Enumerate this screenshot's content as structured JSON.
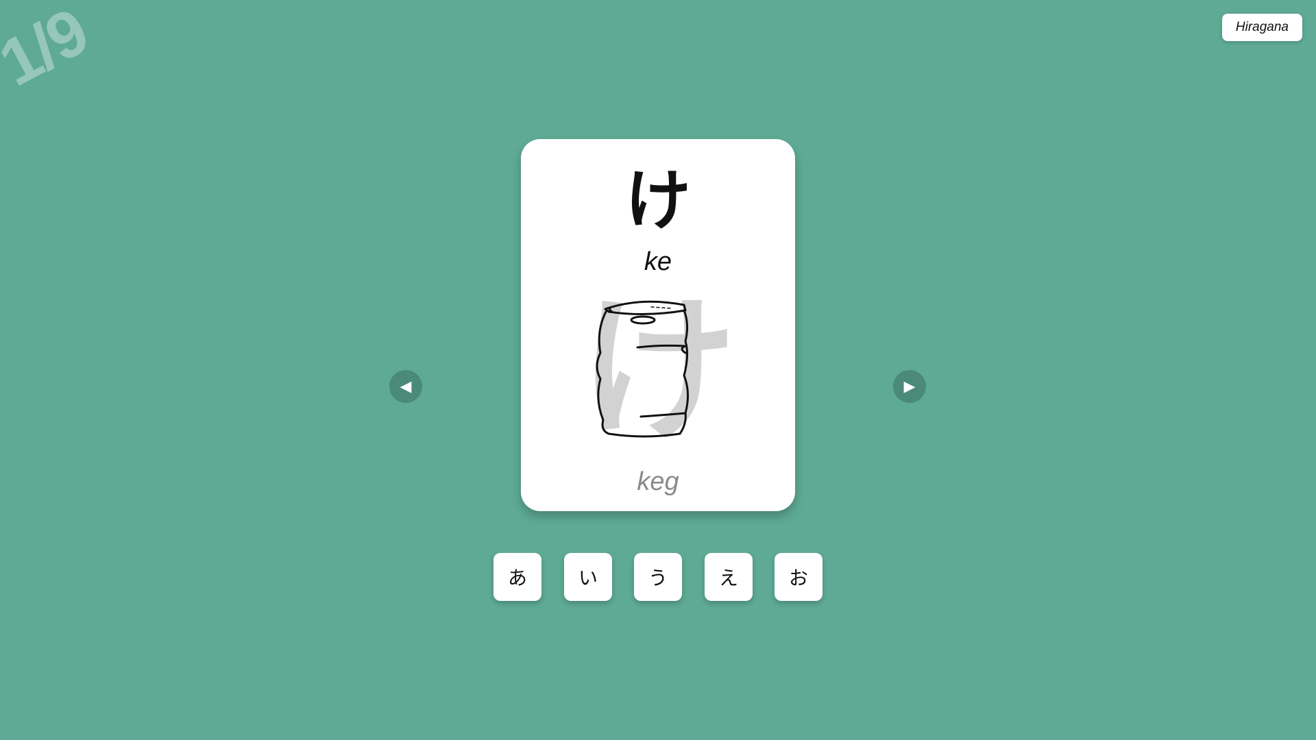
{
  "counter": "1/9",
  "mode_button": "Hiragana",
  "card": {
    "kana": "け",
    "romaji": "ke",
    "ghost_kana": "け",
    "illustration_icon": "keg-drawing",
    "mnemonic": "keg"
  },
  "nav": {
    "prev_icon": "◀",
    "next_icon": "▶"
  },
  "vowels": [
    "あ",
    "い",
    "う",
    "え",
    "お"
  ],
  "colors": {
    "background": "#5eaa94",
    "nav_button": "#4b8a78",
    "card": "#ffffff",
    "ghost_kana": "#d2d2d2",
    "mnemonic_text": "#8a8a8a"
  }
}
